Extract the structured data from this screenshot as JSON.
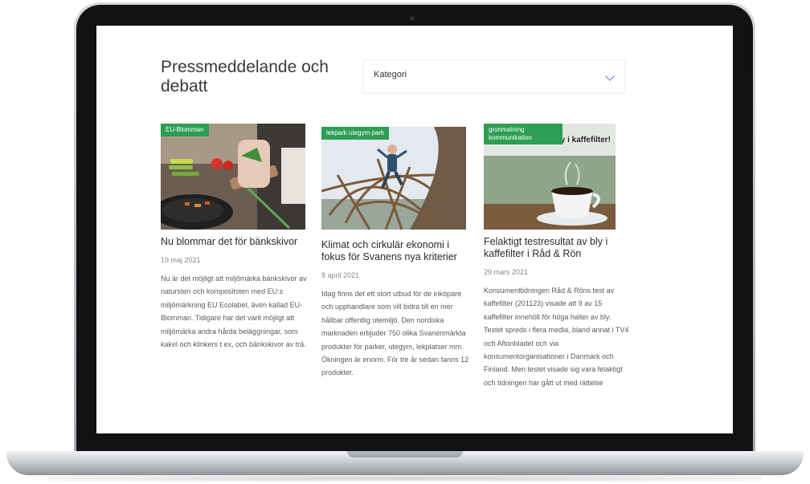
{
  "header": {
    "title": "Pressmeddelande och debatt",
    "category_select": "Kategori"
  },
  "cards": [
    {
      "tag": "EU-Blomman",
      "title": "Nu blommar det för bänkskivor",
      "date": "19 maj 2021",
      "body": "Nu är det möjligt att miljömärka bänkskivor av natursten och kompositsten med EU:s miljömärkning EU Ecolabel, även kallad EU-Blomman. Tidigare har det varit möjligt att miljömärka andra hårda beläggningar, som kakel och klinkers t ex, och bänkskivor av trä."
    },
    {
      "tag": "lekpark utegym park",
      "title": "Klimat och cirkulär ekonomi i fokus för Svanens nya kriterier",
      "date": "8 april 2021",
      "body": "Idag finns det ett stort utbud för de inköpare och upphandlare som vill bidra till en mer hållbar offentlig utemiljö. Den nordiska marknaden erbjuder 750 olika Svanenmärkta produkter för parker, utegym, lekplatser mm. Ökningen är enorm. För tre år sedan fanns 12 produkter."
    },
    {
      "tag": "gronmatning kommunikation",
      "overlay": "... n rättar ... bly i kaffefilter!",
      "title": "Felaktigt testresultat av bly i kaffefilter i Råd & Rön",
      "date": "29 mars 2021",
      "body": "Konsumenttidningen Råd & Röns test av kaffefilter (201123) visade att 9 av 15 kaffefilter innehöll för höga halter av bly. Testet spreds i flera media, bland annat i TV4 och Aftonbladet och via konsumentorganisationer i Danmark och Finland. Men testet visade sig vara felaktigt och tidningen har gått ut med rättelse"
    }
  ]
}
